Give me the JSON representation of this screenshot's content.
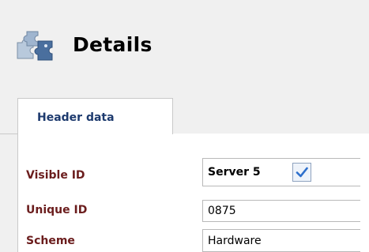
{
  "header": {
    "icon": "puzzle-pieces-icon",
    "title": "Details"
  },
  "tabs": [
    {
      "label": "Header data",
      "active": true
    }
  ],
  "form": {
    "visible_id": {
      "label": "Visible ID",
      "value": "Server 5",
      "checked": true,
      "check_icon": "checkmark-icon"
    },
    "unique_id": {
      "label": "Unique ID",
      "value": "0875"
    },
    "scheme": {
      "label": "Scheme",
      "value": "Hardware"
    }
  },
  "colors": {
    "label_color": "#6b1d1d",
    "tab_label_color": "#1d3a6e",
    "check_color": "#2d6fcc"
  }
}
